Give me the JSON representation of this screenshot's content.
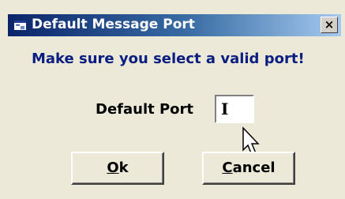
{
  "window": {
    "title": "Default Message Port",
    "close_glyph": "×",
    "icon": "window-app-icon"
  },
  "message": "Make sure you select a valid port!",
  "port": {
    "label": "Default Port",
    "value": "I"
  },
  "buttons": {
    "ok": {
      "mnemonic": "O",
      "rest": "k"
    },
    "cancel": {
      "mnemonic": "C",
      "rest": "ancel"
    }
  },
  "colors": {
    "title_start": "#0a246a",
    "title_end": "#a6caf0",
    "message_text": "#0a1e82",
    "dialog_bg": "#ece9d8"
  }
}
